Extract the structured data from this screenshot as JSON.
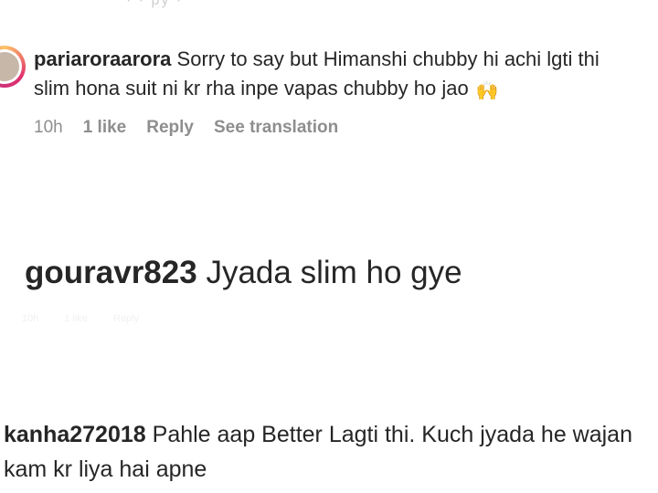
{
  "top_cut_text": "· · py ·",
  "comments": [
    {
      "username": "pariaroraarora",
      "text_line1": "Sorry to say but Himanshi chubby hi achi lgti thi",
      "text_line2": "slim hona suit ni kr rha inpe vapas chubby ho jao",
      "emoji": "🙌",
      "emoji_icon": "raising-hands-emoji",
      "time": "10h",
      "likes": "1 like",
      "reply_label": "Reply",
      "translate_label": "See translation"
    },
    {
      "username": "gouravr823",
      "text": "Jyada slim ho gye",
      "faded_meta": [
        "10h",
        "1 like",
        "Reply"
      ]
    },
    {
      "username": "kanha272018",
      "text_line1": "Pahle aap Better Lagti thi. Kuch jyada he wajan",
      "text_line2": "kam kr liya hai apne"
    }
  ],
  "colors": {
    "text": "#262626",
    "secondary_text": "#8e8e8e",
    "background": "#ffffff",
    "emoji": "#f0b400"
  }
}
